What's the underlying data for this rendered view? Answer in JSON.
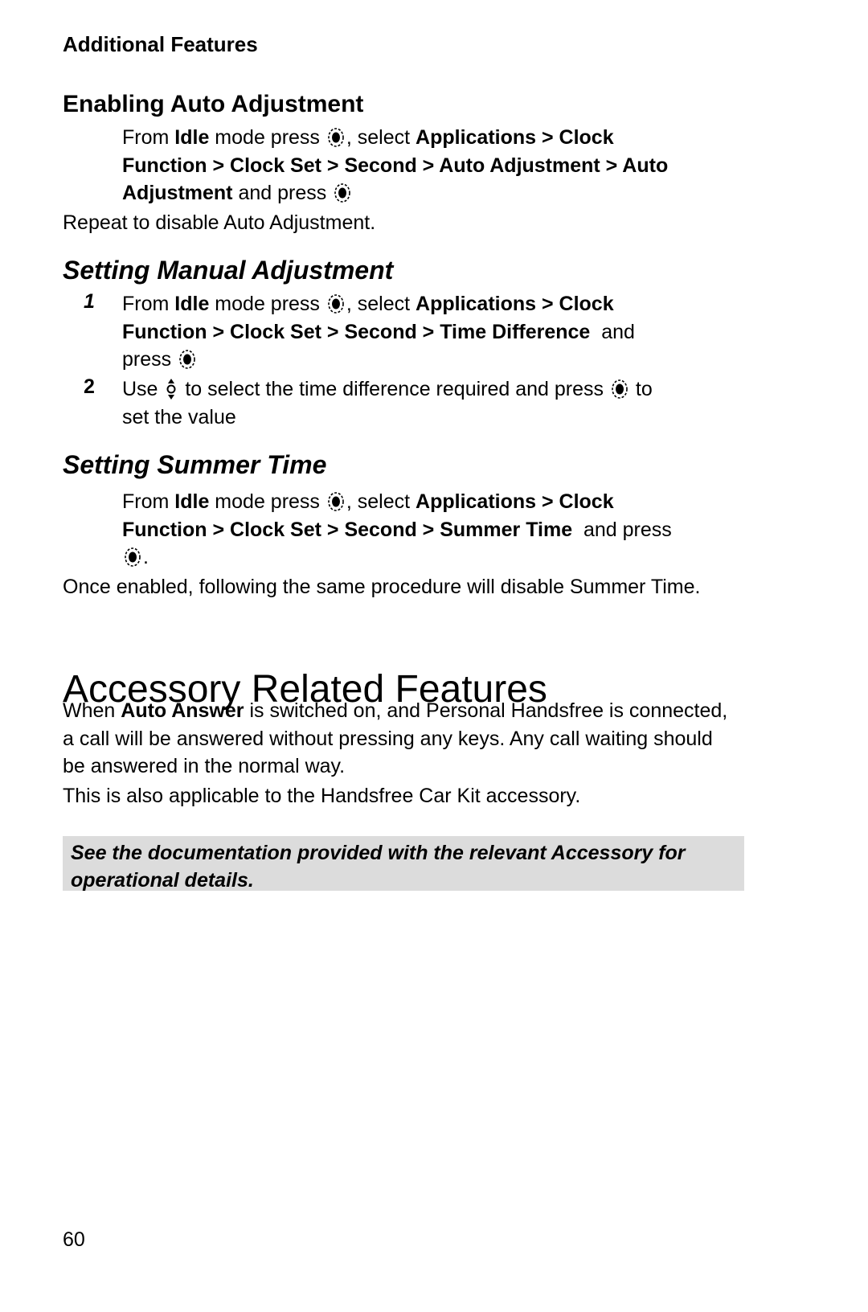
{
  "running_head": "Additional Features",
  "sections": {
    "auto": {
      "title": "Enabling Auto Adjustment",
      "p1": "From ",
      "p1_bold": "Idle",
      "p1b": " mode press ",
      "p1c": ", select ",
      "path1": "Applications > Clock",
      "path2": "Function  > Clock Set > Second > Auto Adjustment > Auto",
      "path3": "Adjustment",
      "end": " and press ",
      "note": "Repeat to disable Auto Adjustment."
    },
    "manual": {
      "title": "Setting Manual Adjustment",
      "step1_num": "1",
      "step1_a": "From ",
      "step1_bold": "Idle",
      "step1_b": " mode press ",
      "step1_c": ", select ",
      "step1_path1": "Applications > Clock",
      "step1_path2": "Function  > Clock Set > Second > Time Difference",
      "step1_and": "  and",
      "step1_press": "press ",
      "step2_num": "2",
      "step2_a": "Use ",
      "step2_b": " to select the time difference required and press ",
      "step2_c": " to",
      "step2_d": "set the value"
    },
    "summer": {
      "title": "Setting Summer Time",
      "p1": "From ",
      "p1_bold": "Idle",
      "p1b": " mode press ",
      "p1c": ", select ",
      "path1": "Applications > Clock",
      "path2": "Function  > Clock Set > Second > Summer Time",
      "end": "  and press",
      "period": ".",
      "note": "Once enabled, following the same procedure will disable Summer Time."
    }
  },
  "accessory": {
    "title": "Accessory Related Features",
    "p1_a": "When ",
    "p1_bold": "Auto Answer",
    "p1_b": " is switched on, and Personal Handsfree is connected, a call will be answered without pressing any keys. Any call waiting should be answered in the normal way.",
    "p2": "This is also applicable to the Handsfree Car Kit accessory.",
    "note": "See the documentation provided with the relevant Accessory for operational details."
  },
  "page_number": "60",
  "colors": {
    "note_bg": "#dcdcdc"
  }
}
